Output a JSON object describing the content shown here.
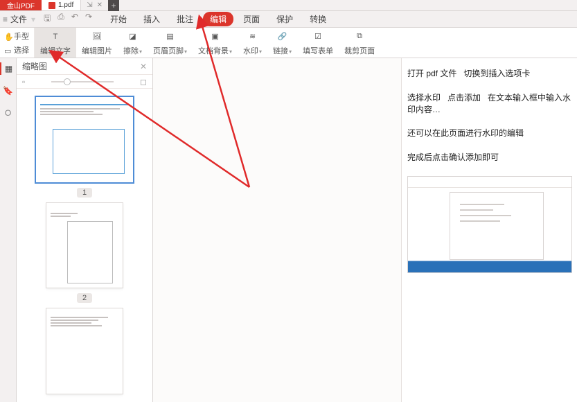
{
  "app": {
    "name": "金山PDF"
  },
  "file_tab": {
    "filename": "1.pdf"
  },
  "menubar": {
    "file_menu": "文件",
    "tabs": [
      {
        "label": "开始"
      },
      {
        "label": "插入"
      },
      {
        "label": "批注"
      },
      {
        "label": "编辑",
        "active": true
      },
      {
        "label": "页面"
      },
      {
        "label": "保护"
      },
      {
        "label": "转换"
      }
    ]
  },
  "ribbon": {
    "hand_label": "手型",
    "select_label": "选择",
    "buttons": [
      {
        "id": "edit-text",
        "label": "编辑文字",
        "active": true
      },
      {
        "id": "edit-image",
        "label": "编辑图片"
      },
      {
        "id": "erase",
        "label": "擦除",
        "drop": true
      },
      {
        "id": "header-footer",
        "label": "页眉页脚",
        "drop": true
      },
      {
        "id": "doc-bg",
        "label": "文档背景",
        "drop": true
      },
      {
        "id": "watermark",
        "label": "水印",
        "drop": true
      },
      {
        "id": "link",
        "label": "链接",
        "drop": true
      },
      {
        "id": "fill-form",
        "label": "填写表单"
      },
      {
        "id": "crop",
        "label": "裁剪页面"
      }
    ]
  },
  "thumbs": {
    "title": "缩略图",
    "pages": [
      {
        "num": "1"
      },
      {
        "num": "2"
      }
    ]
  },
  "tutorial": {
    "l1": "打开 pdf 文件   切换到插入选项卡",
    "l2": "选择水印   点击添加   在文本输入框中输入水印内容…",
    "l3": "还可以在此页面进行水印的编辑",
    "l4": "完成后点击确认添加即可"
  }
}
